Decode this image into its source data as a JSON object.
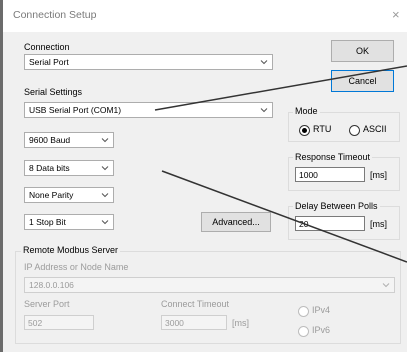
{
  "window": {
    "title": "Connection Setup",
    "close_glyph": "×"
  },
  "connection": {
    "label": "Connection",
    "value": "Serial Port"
  },
  "buttons": {
    "ok": "OK",
    "cancel": "Cancel",
    "advanced": "Advanced..."
  },
  "serial_settings": {
    "label": "Serial Settings",
    "port": "USB Serial Port (COM1)",
    "baud": "9600 Baud",
    "data_bits": "8 Data bits",
    "parity": "None Parity",
    "stop_bits": "1 Stop Bit"
  },
  "mode": {
    "label": "Mode",
    "rtu": "RTU",
    "ascii": "ASCII",
    "selected": "RTU"
  },
  "response_timeout": {
    "label": "Response Timeout",
    "value": "1000",
    "unit": "[ms]"
  },
  "delay_between_polls": {
    "label": "Delay Between Polls",
    "value": "20",
    "unit": "[ms]"
  },
  "remote_server": {
    "label": "Remote Modbus Server",
    "ip_label": "IP Address or Node Name",
    "ip_value": "128.0.0.106",
    "port_label": "Server Port",
    "port_value": "502",
    "connect_timeout_label": "Connect Timeout",
    "connect_timeout_value": "3000",
    "connect_timeout_unit": "[ms]",
    "ipv4": "IPv4",
    "ipv6": "IPv6"
  },
  "icons": {
    "dropdown": "chevron-down-icon",
    "close": "close-icon"
  },
  "colors": {
    "focus_border": "#0078d7",
    "annotation_line": "#333333",
    "client_bg": "#f0f0f0"
  }
}
